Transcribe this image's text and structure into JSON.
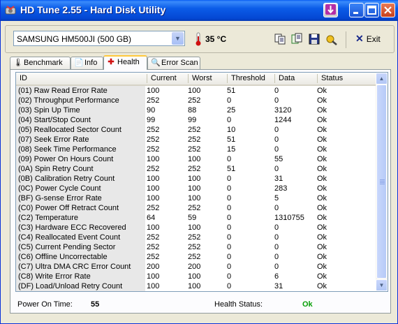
{
  "app": {
    "title": "HD Tune 2.55 - Hard Disk Utility"
  },
  "toolbar": {
    "drive": "SAMSUNG HM500JI (500 GB)",
    "temperature": "35 °C",
    "exit_label": "Exit"
  },
  "tabs": [
    {
      "label": "Benchmark",
      "icon": "benchmark-icon"
    },
    {
      "label": "Info",
      "icon": "info-icon"
    },
    {
      "label": "Health",
      "icon": "health-cross-icon",
      "active": true
    },
    {
      "label": "Error Scan",
      "icon": "magnifier-icon"
    }
  ],
  "table": {
    "columns": [
      "ID",
      "Current",
      "Worst",
      "Threshold",
      "Data",
      "Status"
    ],
    "rows": [
      [
        "(01) Raw Read Error Rate",
        "100",
        "100",
        "51",
        "0",
        "Ok"
      ],
      [
        "(02) Throughput Performance",
        "252",
        "252",
        "0",
        "0",
        "Ok"
      ],
      [
        "(03) Spin Up Time",
        "90",
        "88",
        "25",
        "3120",
        "Ok"
      ],
      [
        "(04) Start/Stop Count",
        "99",
        "99",
        "0",
        "1244",
        "Ok"
      ],
      [
        "(05) Reallocated Sector Count",
        "252",
        "252",
        "10",
        "0",
        "Ok"
      ],
      [
        "(07) Seek Error Rate",
        "252",
        "252",
        "51",
        "0",
        "Ok"
      ],
      [
        "(08) Seek Time Performance",
        "252",
        "252",
        "15",
        "0",
        "Ok"
      ],
      [
        "(09) Power On Hours Count",
        "100",
        "100",
        "0",
        "55",
        "Ok"
      ],
      [
        "(0A) Spin Retry Count",
        "252",
        "252",
        "51",
        "0",
        "Ok"
      ],
      [
        "(0B) Calibration Retry Count",
        "100",
        "100",
        "0",
        "31",
        "Ok"
      ],
      [
        "(0C) Power Cycle Count",
        "100",
        "100",
        "0",
        "283",
        "Ok"
      ],
      [
        "(BF) G-sense Error Rate",
        "100",
        "100",
        "0",
        "5",
        "Ok"
      ],
      [
        "(C0) Power Off Retract Count",
        "252",
        "252",
        "0",
        "0",
        "Ok"
      ],
      [
        "(C2) Temperature",
        "64",
        "59",
        "0",
        "1310755",
        "Ok"
      ],
      [
        "(C3) Hardware ECC Recovered",
        "100",
        "100",
        "0",
        "0",
        "Ok"
      ],
      [
        "(C4) Reallocated Event Count",
        "252",
        "252",
        "0",
        "0",
        "Ok"
      ],
      [
        "(C5) Current Pending Sector",
        "252",
        "252",
        "0",
        "0",
        "Ok"
      ],
      [
        "(C6) Offline Uncorrectable",
        "252",
        "252",
        "0",
        "0",
        "Ok"
      ],
      [
        "(C7) Ultra DMA CRC Error Count",
        "200",
        "200",
        "0",
        "0",
        "Ok"
      ],
      [
        "(C8) Write Error Rate",
        "100",
        "100",
        "0",
        "6",
        "Ok"
      ],
      [
        "(DF) Load/Unload Retry Count",
        "100",
        "100",
        "0",
        "31",
        "Ok"
      ]
    ]
  },
  "footer": {
    "power_on_label": "Power On Time:",
    "power_on_value": "55",
    "health_label": "Health Status:",
    "health_value": "Ok"
  },
  "colors": {
    "title_bar": "#0b5ce8",
    "ok_green": "#08a008",
    "temp_red": "#d01010"
  }
}
